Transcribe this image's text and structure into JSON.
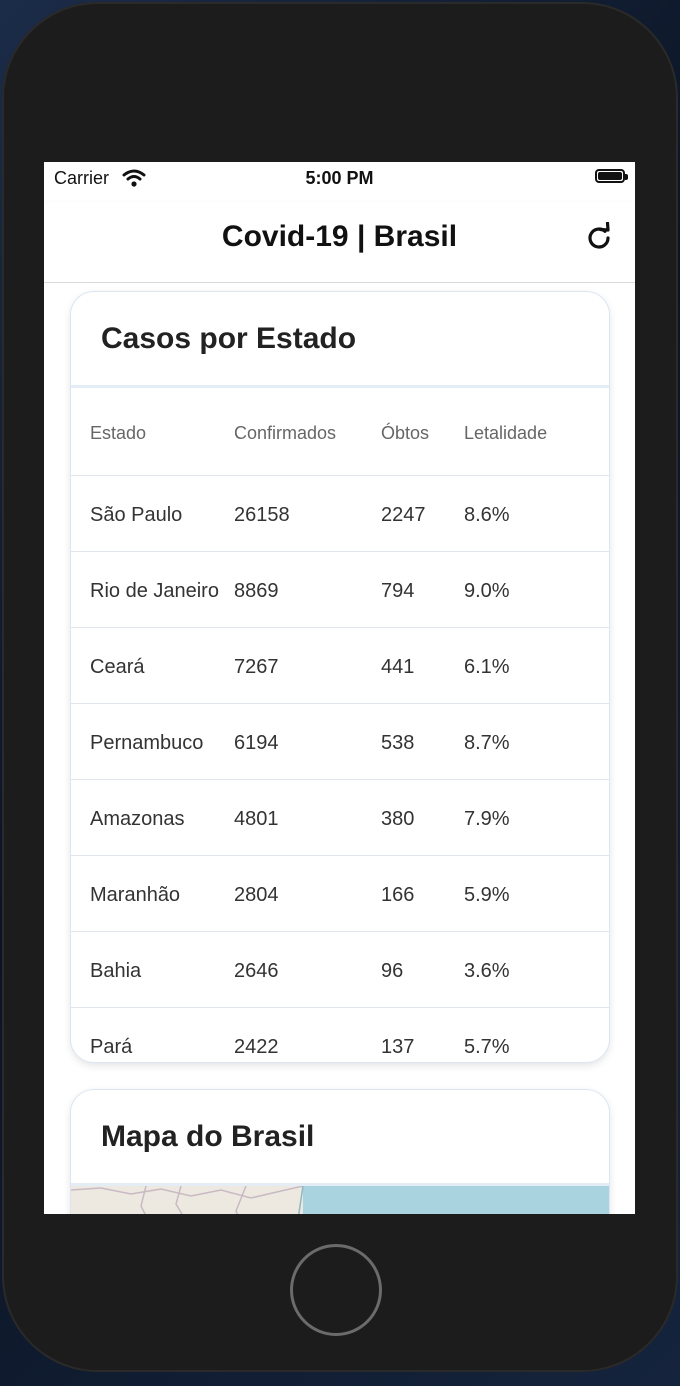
{
  "status_bar": {
    "carrier": "Carrier",
    "time": "5:00 PM",
    "wifi_icon": "wifi-icon",
    "battery_icon": "battery-full-icon"
  },
  "nav": {
    "title": "Covid-19 | Brasil",
    "refresh_icon": "refresh-icon"
  },
  "cases_card": {
    "title": "Casos por Estado",
    "columns": [
      "Estado",
      "Confirmados",
      "Óbtos",
      "Letalidade"
    ],
    "rows": [
      [
        "São Paulo",
        "26158",
        "2247",
        "8.6%"
      ],
      [
        "Rio de Janeiro",
        "8869",
        "794",
        "9.0%"
      ],
      [
        "Ceará",
        "7267",
        "441",
        "6.1%"
      ],
      [
        "Pernambuco",
        "6194",
        "538",
        "8.7%"
      ],
      [
        "Amazonas",
        "4801",
        "380",
        "7.9%"
      ],
      [
        "Maranhão",
        "2804",
        "166",
        "5.9%"
      ],
      [
        "Bahia",
        "2646",
        "96",
        "3.6%"
      ],
      [
        "Pará",
        "2422",
        "137",
        "5.7%"
      ]
    ]
  },
  "map_card": {
    "title": "Mapa do Brasil"
  },
  "colors": {
    "card_border": "#dce6f2",
    "map_land": "#ede9e0",
    "map_sea": "#a9d3de",
    "phone_body": "#1c1c1c"
  }
}
